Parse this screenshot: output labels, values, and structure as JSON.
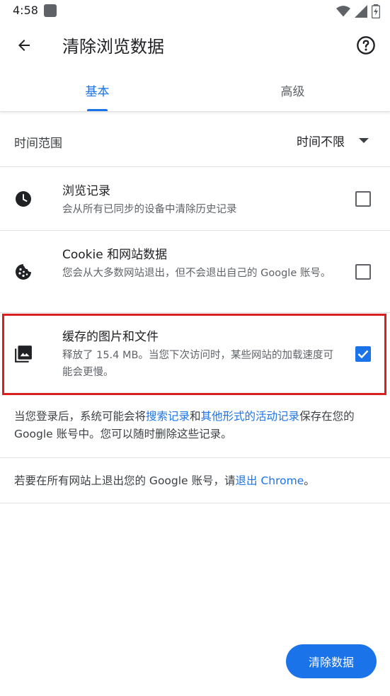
{
  "status_bar": {
    "time": "4:58"
  },
  "app_bar": {
    "title": "清除浏览数据"
  },
  "tabs": [
    {
      "label": "基本",
      "selected": true
    },
    {
      "label": "高级",
      "selected": false
    }
  ],
  "time_range": {
    "label": "时间范围",
    "value": "时间不限"
  },
  "options": [
    {
      "title": "浏览记录",
      "subtitle": "会从所有已同步的设备中清除历史记录",
      "checked": false,
      "icon": "clock-icon"
    },
    {
      "title": "Cookie 和网站数据",
      "subtitle": "您会从大多数网站退出，但不会退出自己的 Google 账号。",
      "checked": false,
      "icon": "cookie-icon"
    },
    {
      "title": "缓存的图片和文件",
      "subtitle": "释放了 15.4 MB。当您下次访问时，某些网站的加载速度可能会更慢。",
      "checked": true,
      "icon": "image-icon"
    }
  ],
  "info_sync": {
    "prefix": "当您登录后，系统可能会将",
    "link1": "搜索记录",
    "middle": "和",
    "link2": "其他形式的活动记录",
    "suffix": "保存在您的 Google 账号中。您可以随时删除这些记录。"
  },
  "info_signout": {
    "prefix": "若要在所有网站上退出您的 Google 账号，请",
    "link": "退出 Chrome",
    "suffix": "。"
  },
  "clear_button": {
    "label": "清除数据"
  },
  "colors": {
    "accent": "#1a73e8",
    "highlight": "#d92020"
  }
}
